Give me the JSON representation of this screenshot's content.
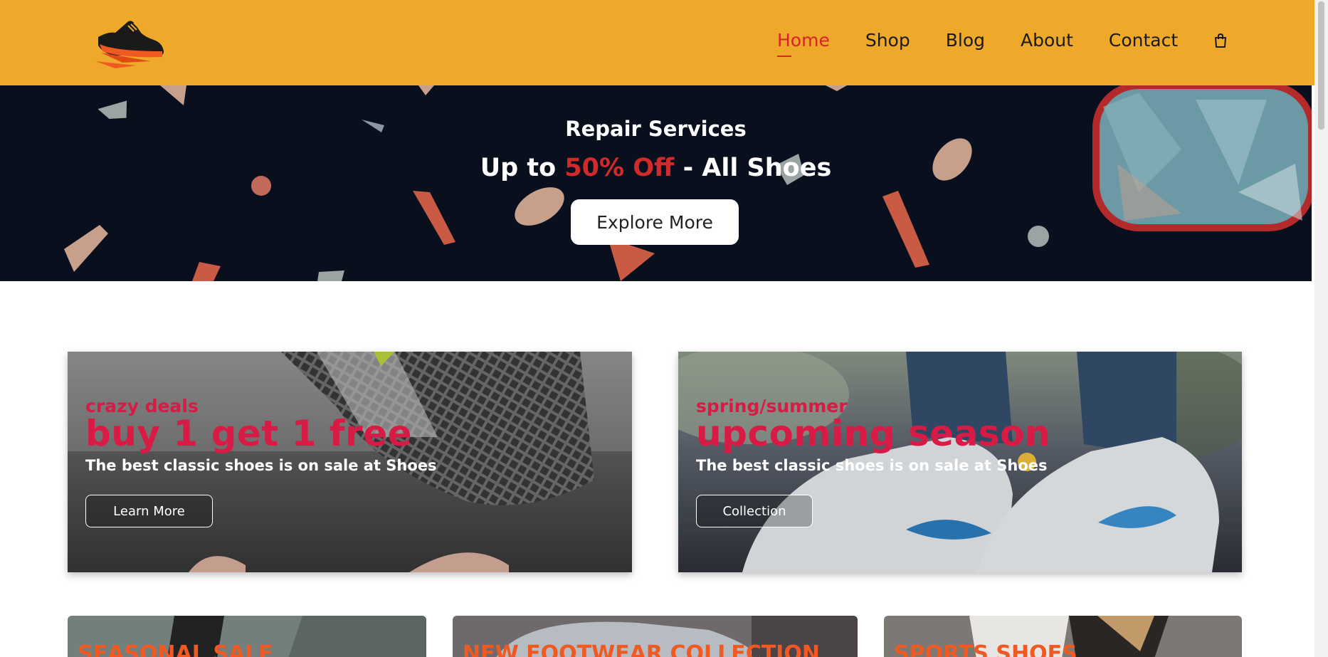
{
  "header": {
    "logo_name": "sneaker-logo",
    "nav": [
      {
        "label": "Home",
        "active": true
      },
      {
        "label": "Shop",
        "active": false
      },
      {
        "label": "Blog",
        "active": false
      },
      {
        "label": "About",
        "active": false
      },
      {
        "label": "Contact",
        "active": false
      }
    ],
    "cart_icon": "shopping-bag-icon",
    "bg_color": "#eea92b",
    "active_color": "#d8232a"
  },
  "hero": {
    "title": "Repair Services",
    "sub_prefix": "Up to ",
    "sub_highlight": "50% Off",
    "sub_suffix": " - All Shoes",
    "button_label": "Explore More"
  },
  "banners": [
    {
      "tag": "crazy deals",
      "headline": "buy 1 get 1 free",
      "description": "The best classic shoes is on sale at Shoes",
      "button_label": "Learn More"
    },
    {
      "tag": "spring/summer",
      "headline": "upcoming season",
      "description": "The best classic shoes is on sale at Shoes",
      "button_label": "Collection"
    }
  ],
  "cards": [
    {
      "title": "SEASONAL SALE"
    },
    {
      "title": "NEW FOOTWEAR COLLECTION"
    },
    {
      "title": "SPORTS SHOES"
    }
  ],
  "accent_colors": {
    "banner_text": "#d81b45",
    "card_text": "#f05a22"
  }
}
